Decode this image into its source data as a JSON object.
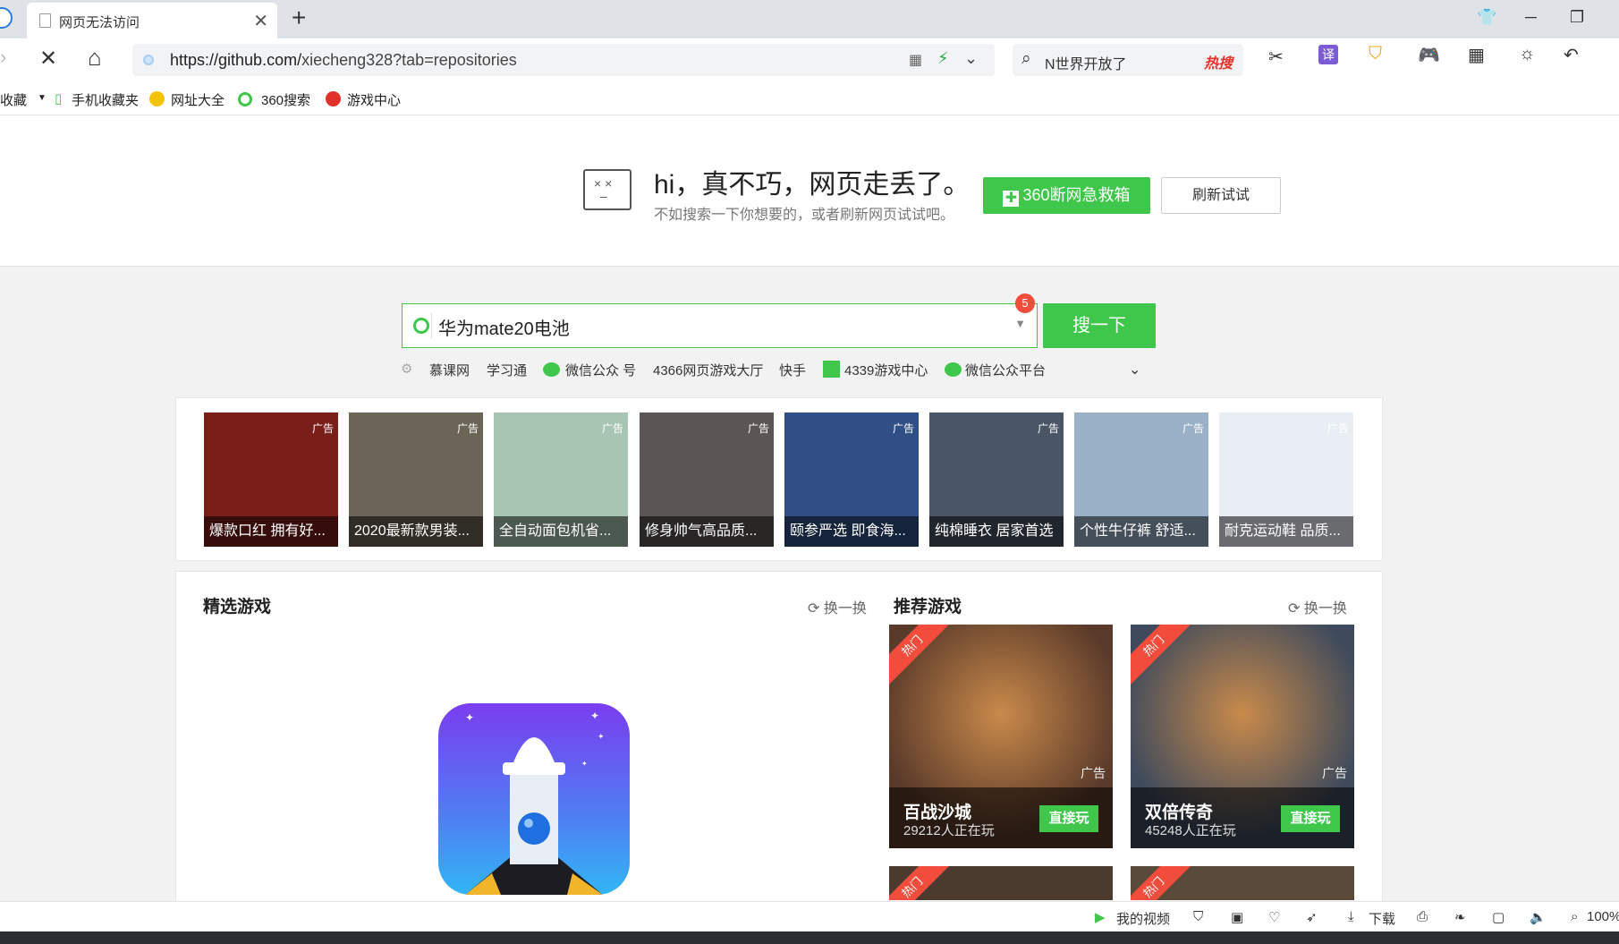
{
  "tab": {
    "title": "网页无法访问"
  },
  "address": {
    "url_host": "https://github.com/",
    "url_path": "xiecheng328?tab=repositories"
  },
  "topsearch": {
    "placeholder": "N世界开放了",
    "hot": "热搜"
  },
  "bookmarks": [
    "收藏",
    "手机收藏夹",
    "网址大全",
    "360搜索",
    "游戏中心"
  ],
  "error": {
    "title": "hi，真不巧，网页走丢了。",
    "subtitle": "不如搜索一下你想要的，或者刷新网页试试吧。",
    "rescue_button": "360断网急救箱",
    "refresh_button": "刷新试试"
  },
  "search": {
    "query": "华为mate20电池",
    "button": "搜一下",
    "badge": "5"
  },
  "quick_links": [
    "慕课网",
    "学习通",
    "微信公众 号",
    "4366网页游戏大厅",
    "快手",
    "4339游戏中心",
    "微信公众平台"
  ],
  "ads": {
    "tag": "广告",
    "items": [
      {
        "caption": "爆款口红 拥有好...",
        "color": "#7a1e1a"
      },
      {
        "caption": "2020最新款男装...",
        "color": "#6b6558"
      },
      {
        "caption": "全自动面包机省...",
        "color": "#a8c5b4"
      },
      {
        "caption": "修身帅气高品质...",
        "color": "#5b5555"
      },
      {
        "caption": "颐参严选 即食海...",
        "color": "#2f4f86"
      },
      {
        "caption": "纯棉睡衣 居家首选",
        "color": "#4a5666"
      },
      {
        "caption": "个性牛仔裤 舒适...",
        "color": "#9ab0c6"
      },
      {
        "caption": "耐克运动鞋 品质...",
        "color": "#e8eef3"
      }
    ]
  },
  "games": {
    "featured_title": "精选游戏",
    "recommended_title": "推荐游戏",
    "swap": "换一换",
    "hot_label": "热门",
    "ad_label": "广告",
    "play_label": "直接玩",
    "cards": [
      {
        "name": "百战沙城",
        "players": "29212人正在玩",
        "color": "#5a3a2a"
      },
      {
        "name": "双倍传奇",
        "players": "45248人正在玩",
        "color": "#3f4b5c"
      }
    ]
  },
  "statusbar": {
    "video": "我的视频",
    "download": "下载",
    "zoom": "100%"
  }
}
